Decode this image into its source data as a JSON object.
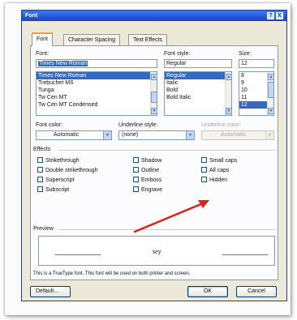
{
  "window": {
    "title": "Font",
    "help_label": "?",
    "close_label": "X"
  },
  "tabs": [
    {
      "label": "Font",
      "active": true
    },
    {
      "label": "Character Spacing",
      "active": false
    },
    {
      "label": "Text Effects",
      "active": false
    }
  ],
  "font": {
    "label": "Font:",
    "value": "Times New Roman",
    "options": [
      "Times New Roman",
      "Trebuchet MS",
      "Tunga",
      "Tw Cen MT",
      "Tw Cen MT Condensed"
    ],
    "selected_index": 0
  },
  "font_style": {
    "label": "Font style:",
    "value": "Regular",
    "options": [
      "Regular",
      "Italic",
      "Bold",
      "Bold Italic"
    ],
    "selected_index": 0
  },
  "size": {
    "label": "Size:",
    "value": "12",
    "options": [
      "8",
      "9",
      "10",
      "11",
      "12"
    ],
    "selected_index": 4
  },
  "font_color": {
    "label": "Font color:",
    "value": "Automatic"
  },
  "underline_style": {
    "label": "Underline style:",
    "value": "(none)"
  },
  "underline_color": {
    "label": "Underline color:",
    "value": "Automatic"
  },
  "effects": {
    "label": "Effects",
    "col1": [
      {
        "label": "Strikethrough",
        "checked": false
      },
      {
        "label": "Double strikethrough",
        "checked": false
      },
      {
        "label": "Superscript",
        "checked": false
      },
      {
        "label": "Subscript",
        "checked": false
      }
    ],
    "col2": [
      {
        "label": "Shadow",
        "checked": false
      },
      {
        "label": "Outline",
        "checked": false
      },
      {
        "label": "Emboss",
        "checked": false
      },
      {
        "label": "Engrave",
        "checked": false
      }
    ],
    "col3": [
      {
        "label": "Small caps",
        "checked": false
      },
      {
        "label": "All caps",
        "checked": false
      },
      {
        "label": "Hidden",
        "checked": false
      }
    ]
  },
  "preview": {
    "label": "Preview",
    "sample_text": "sey",
    "note": "This is a TrueType font. This font will be used on both printer and screen."
  },
  "buttons": {
    "default_label": "Default...",
    "ok_label": "OK",
    "cancel_label": "Cancel"
  },
  "colors": {
    "annotation_arrow": "#e0201b",
    "title_bar": "#1f52d6",
    "selection": "#316ac5"
  }
}
